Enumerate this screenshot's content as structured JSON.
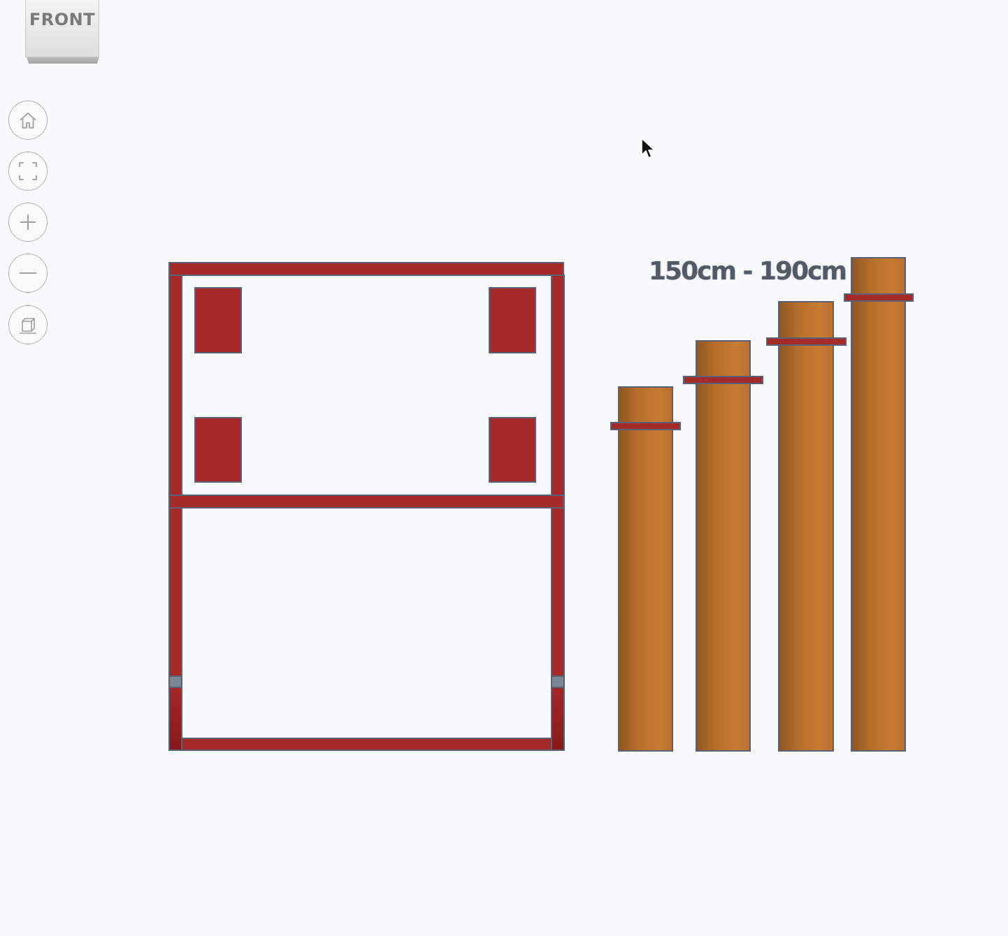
{
  "view_cube": {
    "face_label": "FRONT"
  },
  "toolbar": {
    "buttons": [
      {
        "name": "home-view",
        "icon": "home-icon"
      },
      {
        "name": "fit-all",
        "icon": "fit-frame-icon"
      },
      {
        "name": "zoom-in",
        "icon": "plus-icon"
      },
      {
        "name": "zoom-out",
        "icon": "minus-icon"
      },
      {
        "name": "perspective",
        "icon": "perspective-cube-icon"
      }
    ]
  },
  "scene": {
    "dimension_label": "150cm - 190cm",
    "colors": {
      "frame": "#a52a2a",
      "frame_outline": "#5c6273",
      "post": "#c27830",
      "post_shadow": "#8f5520",
      "background": "#f8f9fa"
    }
  }
}
